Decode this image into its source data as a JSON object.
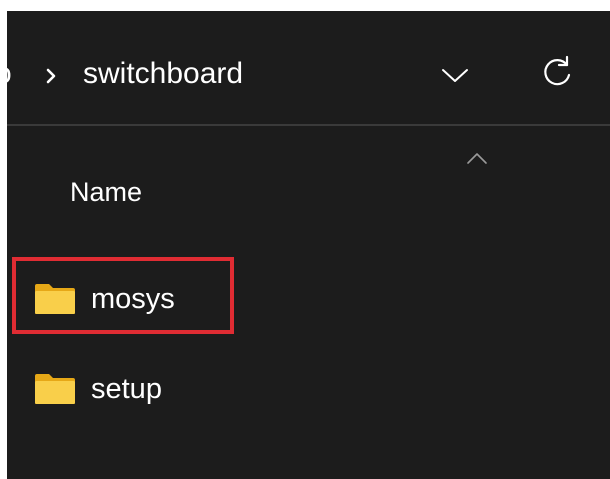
{
  "address_bar": {
    "partial_crumb": "o",
    "separator": "chevron-right-icon",
    "current_folder": "switchboard",
    "dropdown_icon": "chevron-down-icon",
    "refresh_icon": "refresh-icon"
  },
  "file_list": {
    "column_header": "Name",
    "sort_icon": "sort-ascending-icon",
    "items": [
      {
        "label": "mosys",
        "icon": "folder-icon",
        "highlighted": true
      },
      {
        "label": "setup",
        "icon": "folder-icon",
        "highlighted": false
      }
    ]
  },
  "colors": {
    "window_background": "#1c1c1c",
    "text": "#ffffff",
    "highlight_border": "#e02c33",
    "folder_yellow": "#f5c542"
  }
}
